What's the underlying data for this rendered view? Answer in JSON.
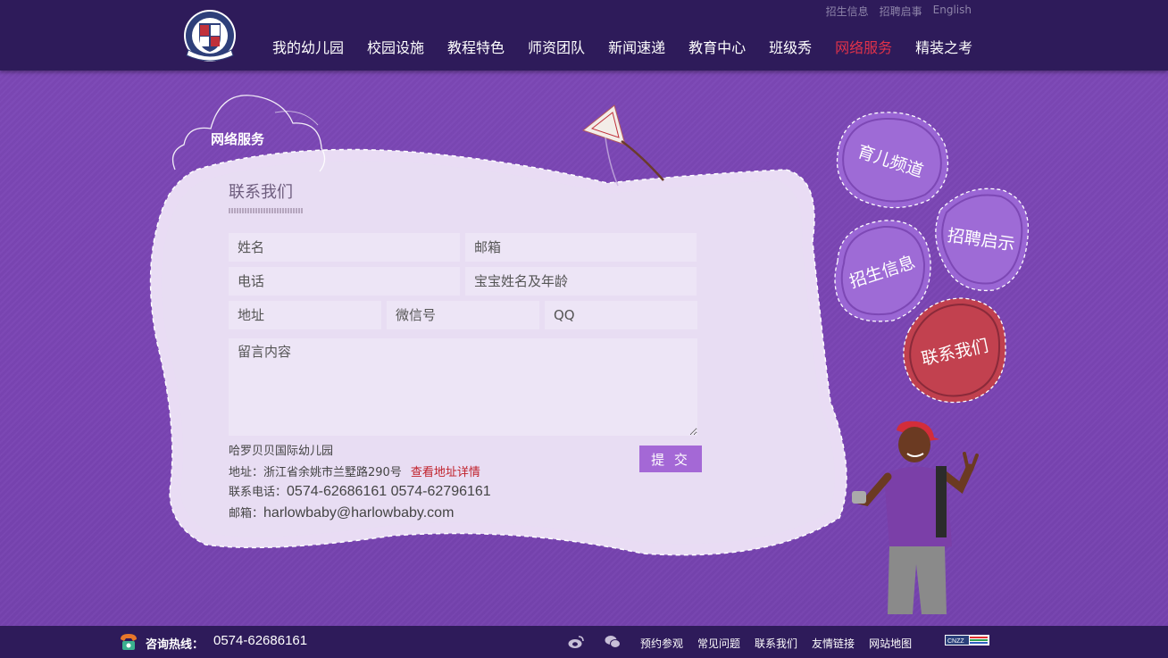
{
  "top_links": [
    "招生信息",
    "招聘启事",
    "English"
  ],
  "nav": [
    {
      "label": "我的幼儿园"
    },
    {
      "label": "校园设施"
    },
    {
      "label": "教程特色"
    },
    {
      "label": "师资团队"
    },
    {
      "label": "新闻速递"
    },
    {
      "label": "教育中心"
    },
    {
      "label": "班级秀"
    },
    {
      "label": "网络服务",
      "active": true
    },
    {
      "label": "精装之考"
    }
  ],
  "cloud_title": "网络服务",
  "section_title": "联系我们",
  "form": {
    "name_placeholder": "姓名",
    "email_placeholder": "邮箱",
    "phone_placeholder": "电话",
    "baby_placeholder": "宝宝姓名及年龄",
    "address_placeholder": "地址",
    "wechat_placeholder": "微信号",
    "qq_placeholder": "QQ",
    "message_placeholder": "留言内容",
    "submit_label": "提 交"
  },
  "info": {
    "school_name": "哈罗贝贝国际幼儿园",
    "address_label": "地址：浙江省余姚市兰墅路290号",
    "address_link": "查看地址详情",
    "phone_label": "联系电话：",
    "phone_value": "0574-62686161 0574-62796161",
    "email_label": "邮箱：",
    "email_value": "harlowbaby@harlowbaby.com"
  },
  "bubbles": {
    "parenting": "育儿频道",
    "recruitment": "招聘启示",
    "admissions": "招生信息",
    "contact": "联系我们"
  },
  "footer": {
    "hotline_label": "咨询热线：",
    "hotline_number": "0574-62686161",
    "links": [
      "预约参观",
      "常见问题",
      "联系我们",
      "友情链接",
      "网站地图"
    ],
    "cnzz": "CNZZ"
  },
  "colors": {
    "header_bg": "#2e1b5a",
    "page_bg": "#7a45b3",
    "nav_active": "#e0324a",
    "submit_bg": "#a468d6",
    "bubble_purple": "#9a66d4",
    "bubble_red": "#c0404e"
  }
}
